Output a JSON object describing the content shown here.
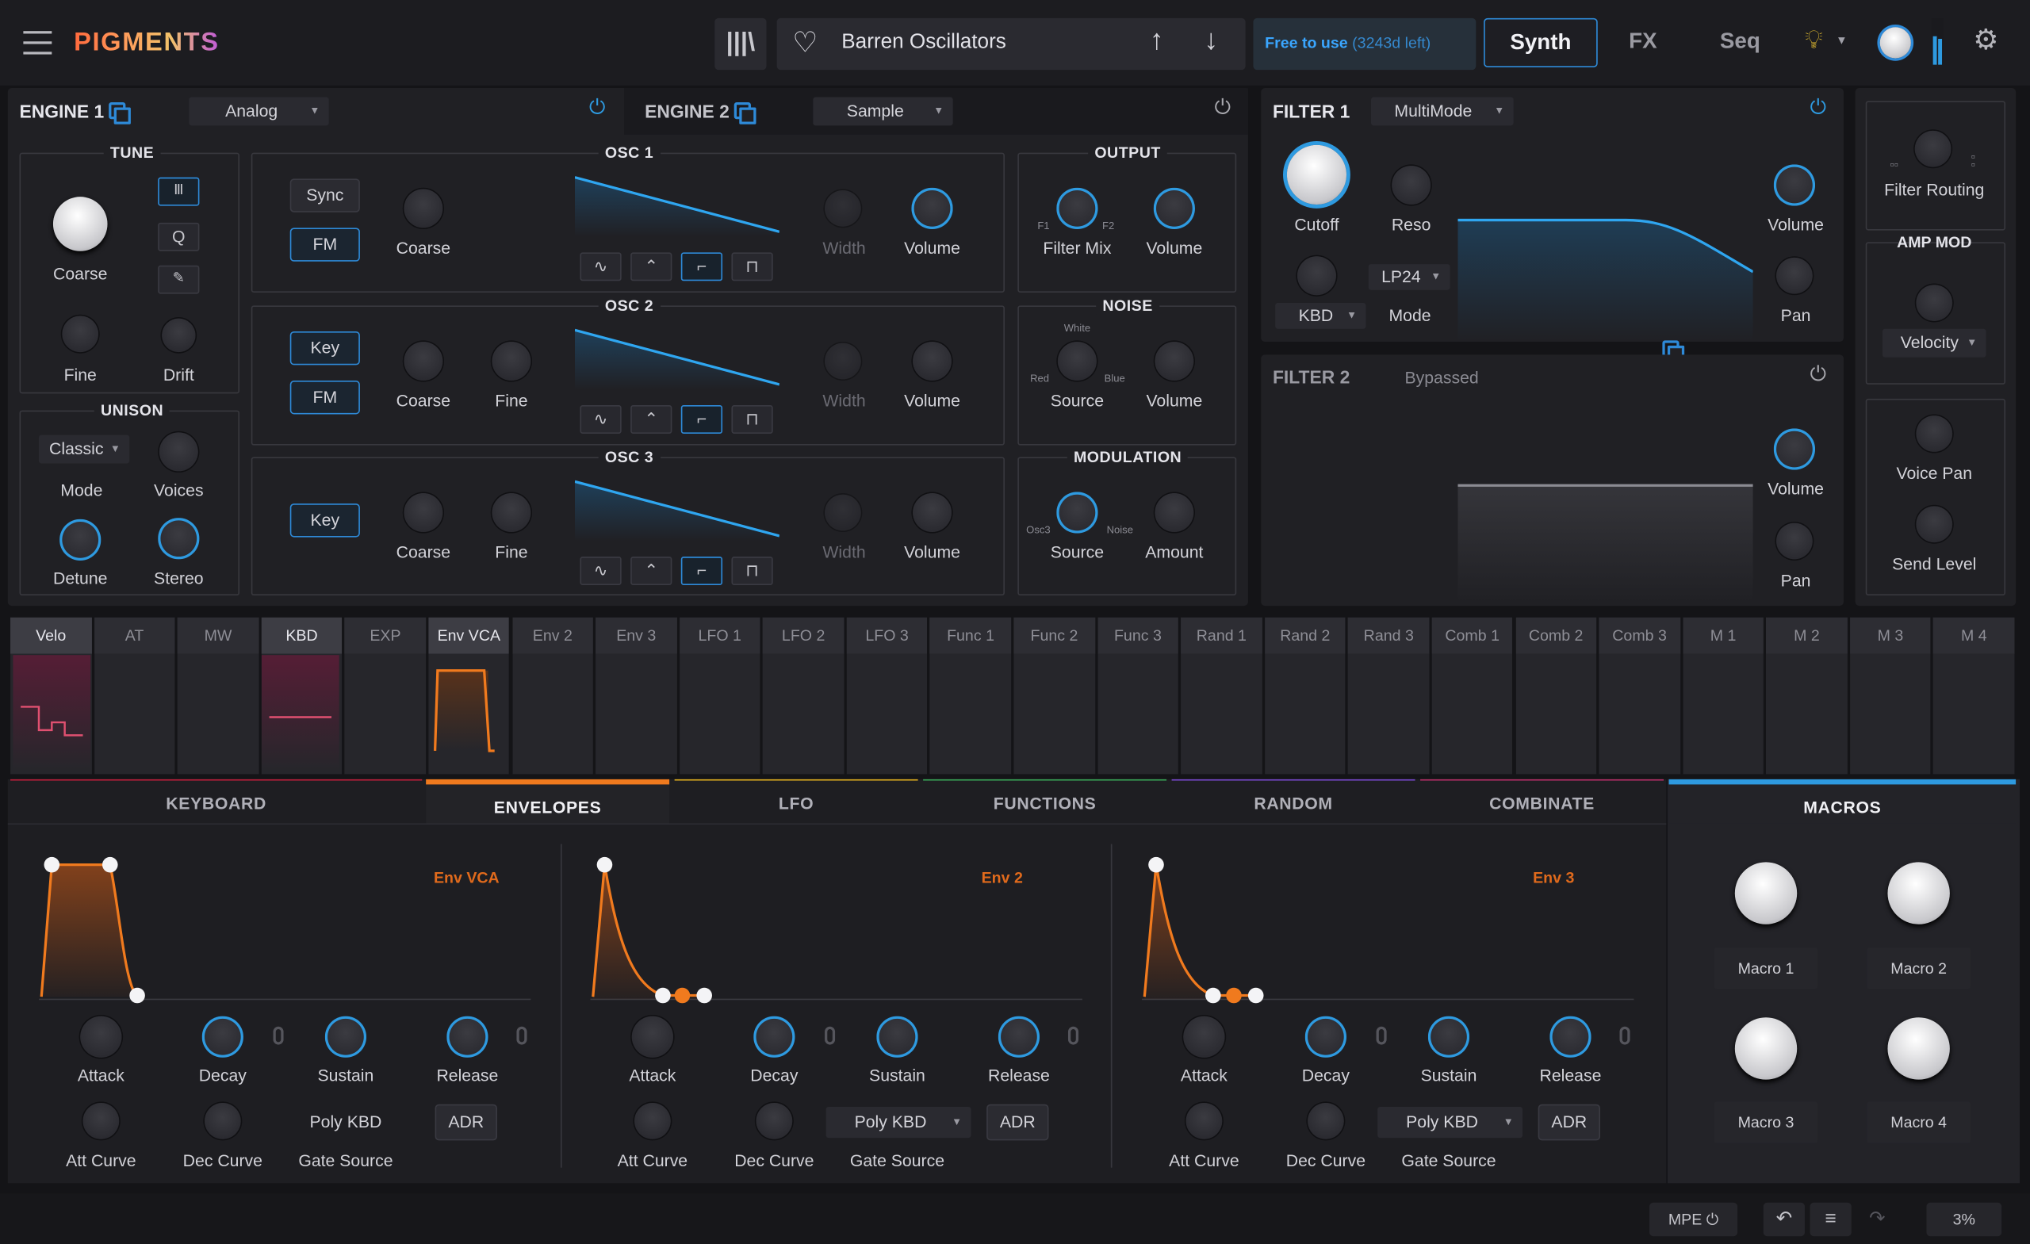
{
  "app": {
    "logo": "PIGMENTS"
  },
  "topbar": {
    "preset_name": "Barren Oscillators",
    "license_text": "Free to use",
    "license_days": "(3243d left)",
    "tabs": [
      "Synth",
      "FX",
      "Seq"
    ],
    "active_tab": "Synth",
    "accent": "#2e8ad8"
  },
  "engine1": {
    "title": "ENGINE 1",
    "type": "Analog",
    "tune": {
      "title": "TUNE",
      "coarse": "Coarse",
      "fine": "Fine",
      "drift": "Drift",
      "btn_q": "Q"
    },
    "unison": {
      "title": "UNISON",
      "mode_value": "Classic",
      "mode": "Mode",
      "voices": "Voices",
      "detune": "Detune",
      "stereo": "Stereo"
    },
    "osc1": {
      "title": "OSC 1",
      "sync": "Sync",
      "fm": "FM",
      "coarse": "Coarse",
      "width": "Width",
      "volume": "Volume"
    },
    "osc2": {
      "title": "OSC 2",
      "key": "Key",
      "fm": "FM",
      "coarse": "Coarse",
      "fine": "Fine",
      "width": "Width",
      "volume": "Volume"
    },
    "osc3": {
      "title": "OSC 3",
      "key": "Key",
      "coarse": "Coarse",
      "fine": "Fine",
      "width": "Width",
      "volume": "Volume"
    },
    "output": {
      "title": "OUTPUT",
      "f1": "F1",
      "f2": "F2",
      "filter_mix": "Filter Mix",
      "volume": "Volume"
    },
    "noise": {
      "title": "NOISE",
      "white": "White",
      "red": "Red",
      "blue": "Blue",
      "source": "Source",
      "volume": "Volume"
    },
    "modulation": {
      "title": "MODULATION",
      "osc3": "Osc3",
      "noise": "Noise",
      "source": "Source",
      "amount": "Amount"
    }
  },
  "engine2": {
    "title": "ENGINE 2",
    "type": "Sample"
  },
  "filter1": {
    "title": "FILTER 1",
    "type": "MultiMode",
    "cutoff": "Cutoff",
    "reso": "Reso",
    "kbd": "KBD",
    "mode_value": "LP24",
    "mode": "Mode",
    "volume": "Volume",
    "pan": "Pan"
  },
  "filter2": {
    "title": "FILTER 2",
    "state": "Bypassed",
    "volume": "Volume",
    "pan": "Pan"
  },
  "routing": {
    "filter_routing": "Filter Routing",
    "amp_mod": "AMP MOD",
    "velocity": "Velocity",
    "voice_pan": "Voice Pan",
    "send_level": "Send Level"
  },
  "mod_sources": [
    "Velo",
    "AT",
    "MW",
    "KBD",
    "EXP",
    "Env VCA",
    "Env 2",
    "Env 3",
    "LFO 1",
    "LFO 2",
    "LFO 3",
    "Func 1",
    "Func 2",
    "Func 3",
    "Rand 1",
    "Rand 2",
    "Rand 3",
    "Comb 1",
    "Comb 2",
    "Comb 3",
    "M 1",
    "M 2",
    "M 3",
    "M 4"
  ],
  "bottom_tabs": [
    "KEYBOARD",
    "ENVELOPES",
    "LFO",
    "FUNCTIONS",
    "RANDOM",
    "COMBINATE",
    "MACROS"
  ],
  "bottom_tab_colors": [
    "#c0203c",
    "#f07a1e",
    "#e0b020",
    "#3aa858",
    "#7a4ad0",
    "#b8306a",
    "#2e9ae0"
  ],
  "envelopes": [
    {
      "name": "Env VCA",
      "attack": "Attack",
      "decay": "Decay",
      "sustain": "Sustain",
      "release": "Release",
      "att_curve": "Att Curve",
      "dec_curve": "Dec Curve",
      "gate_value": "Poly KBD",
      "gate_source": "Gate Source",
      "mode": "ADR"
    },
    {
      "name": "Env 2",
      "attack": "Attack",
      "decay": "Decay",
      "sustain": "Sustain",
      "release": "Release",
      "att_curve": "Att Curve",
      "dec_curve": "Dec Curve",
      "gate_value": "Poly KBD",
      "gate_source": "Gate Source",
      "mode": "ADR"
    },
    {
      "name": "Env 3",
      "attack": "Attack",
      "decay": "Decay",
      "sustain": "Sustain",
      "release": "Release",
      "att_curve": "Att Curve",
      "dec_curve": "Dec Curve",
      "gate_value": "Poly KBD",
      "gate_source": "Gate Source",
      "mode": "ADR"
    }
  ],
  "macros": [
    "Macro 1",
    "Macro 2",
    "Macro 3",
    "Macro 4"
  ],
  "statusbar": {
    "mpe": "MPE",
    "cpu": "3%"
  }
}
